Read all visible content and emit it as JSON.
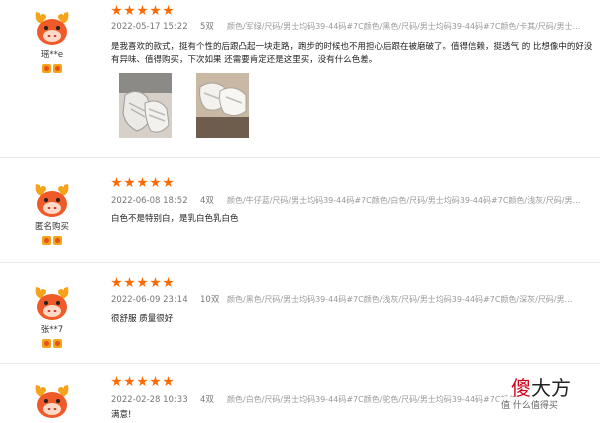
{
  "reviews": [
    {
      "username": "瑶**e",
      "date": "2022-05-17 15:22",
      "quantity": "5双",
      "sku": "颜色/军绿/尺码/男士均码39-44码#7C颜色/黑色/尺码/男士均码39-44码#7C颜色/卡其/尺码/男士…",
      "content": "是我喜欢的款式，挺有个性的后跟凸起一块走路，跑步的时候也不用担心后跟在被磨破了。值得信赖，挺透气 的 比想像中的好没有异味、值得购买，下次如果 还需要肯定还是这里买，没有什么色差。",
      "rating": 5,
      "photo_count": 2
    },
    {
      "username": "匿名购买",
      "date": "2022-06-08 18:52",
      "quantity": "4双",
      "sku": "颜色/牛仔蓝/尺码/男士均码39-44码#7C颜色/白色/尺码/男士均码39-44码#7C颜色/浅灰/尺码/男…",
      "content": "白色不是特别白，是乳白色乳白色",
      "rating": 5
    },
    {
      "username": "张**7",
      "date": "2022-06-09 23:14",
      "quantity": "10双",
      "sku": "颜色/黑色/尺码/男士均码39-44码#7C颜色/浅灰/尺码/男士均码39-44码#7C颜色/深灰/尺码/男…",
      "content": "很舒服 质量很好",
      "rating": 5
    },
    {
      "username": "",
      "date": "2022-02-28 10:33",
      "quantity": "4双",
      "sku": "颜色/白色/尺码/男士均码39-44码#7C颜色/驼色/尺码/男士均码39-44码#7C颜色/…",
      "content": "满意!",
      "rating": 5
    }
  ],
  "watermark": {
    "logo_red": "傻",
    "logo_dark": "大方",
    "tagline": "值 什么值得买"
  },
  "colors": {
    "star": "#ff6a00",
    "avatar_face": "#f05a28",
    "avatar_horns": "#f5a31a",
    "text": "#222222",
    "meta": "#777777"
  },
  "icons": [
    "mascot-avatar-icon",
    "star-icon",
    "medal-badge-icon"
  ]
}
